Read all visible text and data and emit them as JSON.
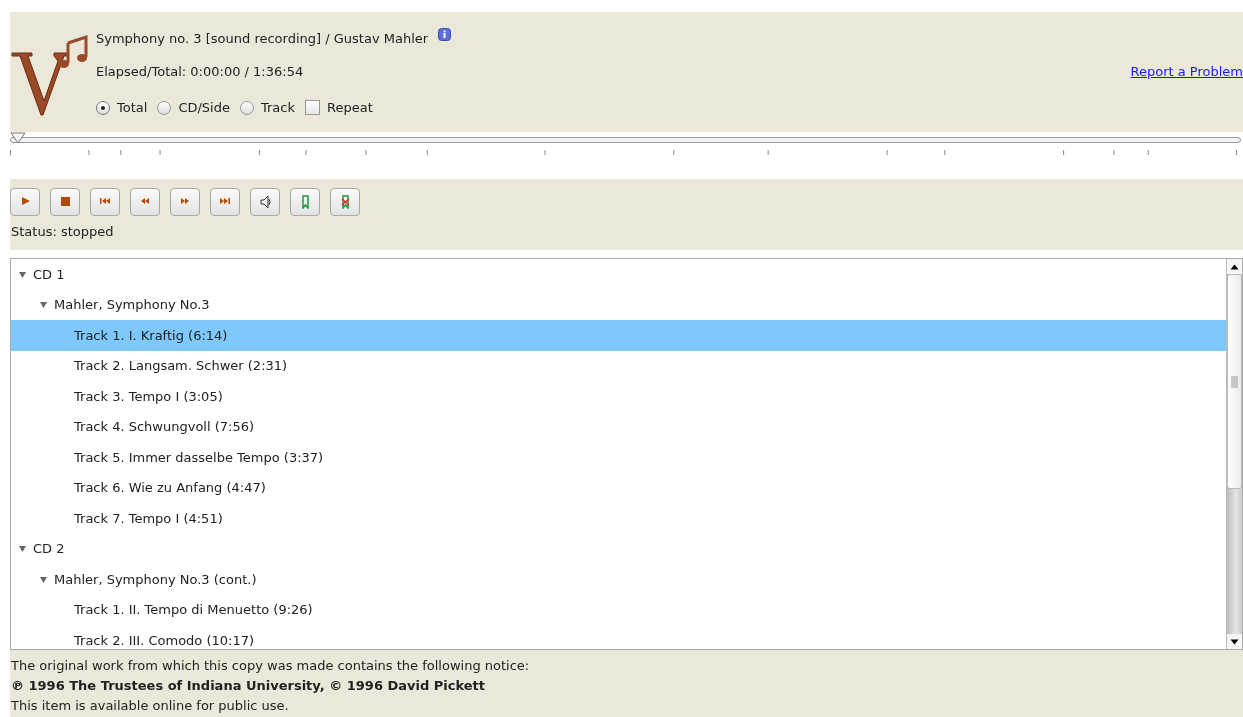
{
  "header": {
    "title": "Symphony no. 3 [sound recording] / Gustav Mahler",
    "elapsed": "Elapsed/Total: 0:00:00 / 1:36:54",
    "report_link": "Report a Problem",
    "modes": [
      {
        "label": "Total",
        "selected": true
      },
      {
        "label": "CD/Side",
        "selected": false
      },
      {
        "label": "Track",
        "selected": false
      }
    ],
    "repeat": {
      "label": "Repeat",
      "checked": false
    }
  },
  "position_slider": {
    "level": 0
  },
  "controls": [
    {
      "kind": "play"
    },
    {
      "kind": "stop"
    },
    {
      "kind": "first"
    },
    {
      "kind": "rewind"
    },
    {
      "kind": "forward"
    },
    {
      "kind": "last"
    },
    {
      "kind": "volume"
    },
    {
      "kind": "bookmark-add"
    },
    {
      "kind": "bookmark-remove"
    }
  ],
  "status": "Status: stopped",
  "tracklist": [
    {
      "label": "CD 1",
      "expanded": true,
      "children": [
        {
          "label": "Mahler, Symphony No.3",
          "expanded": true,
          "children": [
            {
              "label": "Track 1. I. Kraftig (6:14)",
              "selected": true
            },
            {
              "label": "Track 2. Langsam. Schwer (2:31)",
              "selected": false
            },
            {
              "label": "Track 3. Tempo I (3:05)",
              "selected": false
            },
            {
              "label": "Track 4. Schwungvoll (7:56)",
              "selected": false
            },
            {
              "label": "Track 5. Immer dasselbe Tempo (3:37)",
              "selected": false
            },
            {
              "label": "Track 6. Wie zu Anfang (4:47)",
              "selected": false
            },
            {
              "label": "Track 7. Tempo I (4:51)",
              "selected": false
            }
          ]
        }
      ]
    },
    {
      "label": "CD 2",
      "expanded": true,
      "children": [
        {
          "label": "Mahler, Symphony No.3 (cont.)",
          "expanded": true,
          "children": [
            {
              "label": "Track 1. II. Tempo di Menuetto (9:26)",
              "selected": false
            },
            {
              "label": "Track 2. III. Comodo (10:17)",
              "selected": false
            }
          ]
        }
      ]
    }
  ],
  "notice": {
    "intro": "The original work from which this copy was made contains the following notice:",
    "copyright": "℗ 1996 The Trustees of Indiana University, © 1996 David Pickett",
    "availability": "This item is available online for public use."
  }
}
